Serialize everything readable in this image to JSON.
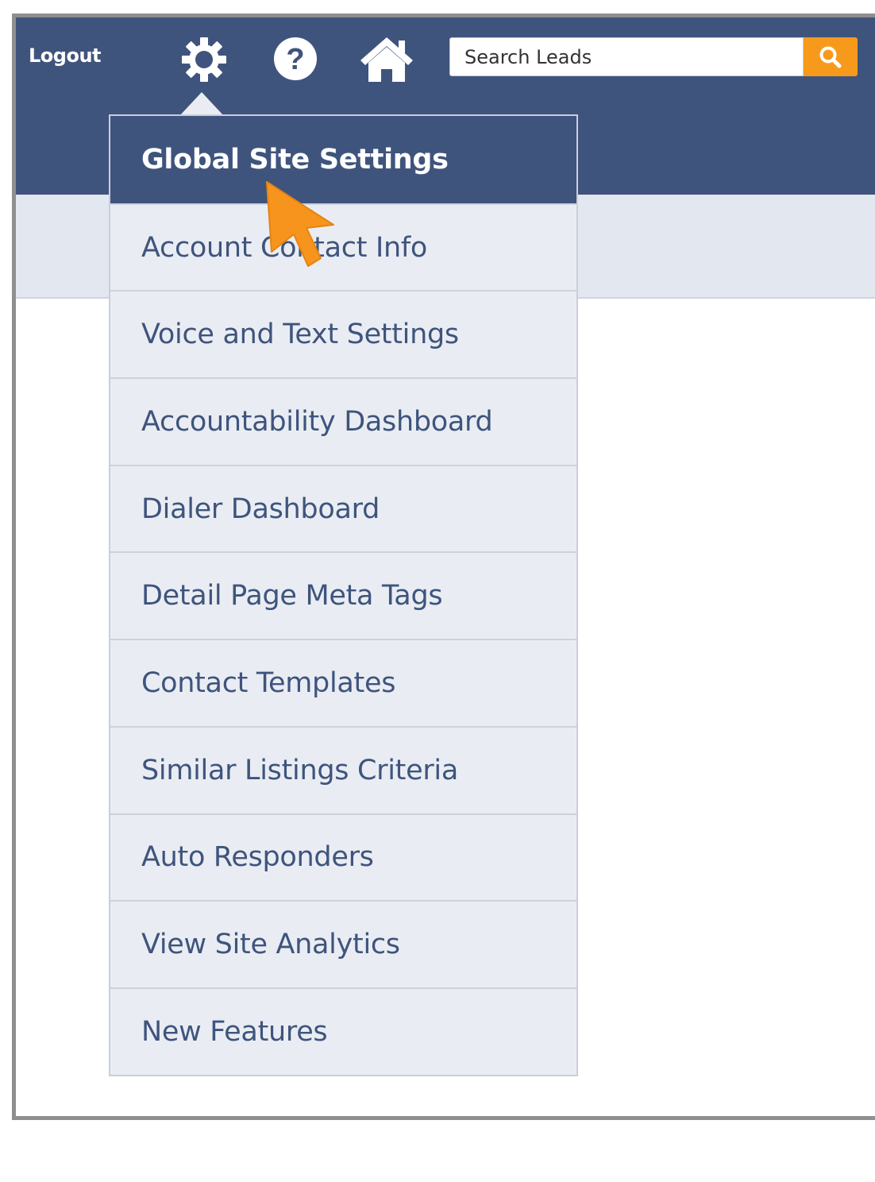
{
  "header": {
    "logout_label": "Logout",
    "icons": [
      "gear-icon",
      "help-icon",
      "home-icon"
    ],
    "search": {
      "placeholder": "Search Leads",
      "button_icon": "search-icon"
    }
  },
  "settings_menu": {
    "items": [
      {
        "label": "Global Site Settings",
        "active": true
      },
      {
        "label": "Account Contact Info"
      },
      {
        "label": "Voice and Text Settings"
      },
      {
        "label": "Accountability Dashboard"
      },
      {
        "label": "Dialer Dashboard"
      },
      {
        "label": "Detail Page Meta Tags"
      },
      {
        "label": "Contact Templates"
      },
      {
        "label": "Similar Listings Criteria"
      },
      {
        "label": "Auto Responders"
      },
      {
        "label": "View Site Analytics"
      },
      {
        "label": "New Features"
      }
    ]
  },
  "colors": {
    "header_bg": "#3f547d",
    "menu_bg": "#e9edf3",
    "accent": "#f79a1c",
    "text": "#3f547d"
  }
}
